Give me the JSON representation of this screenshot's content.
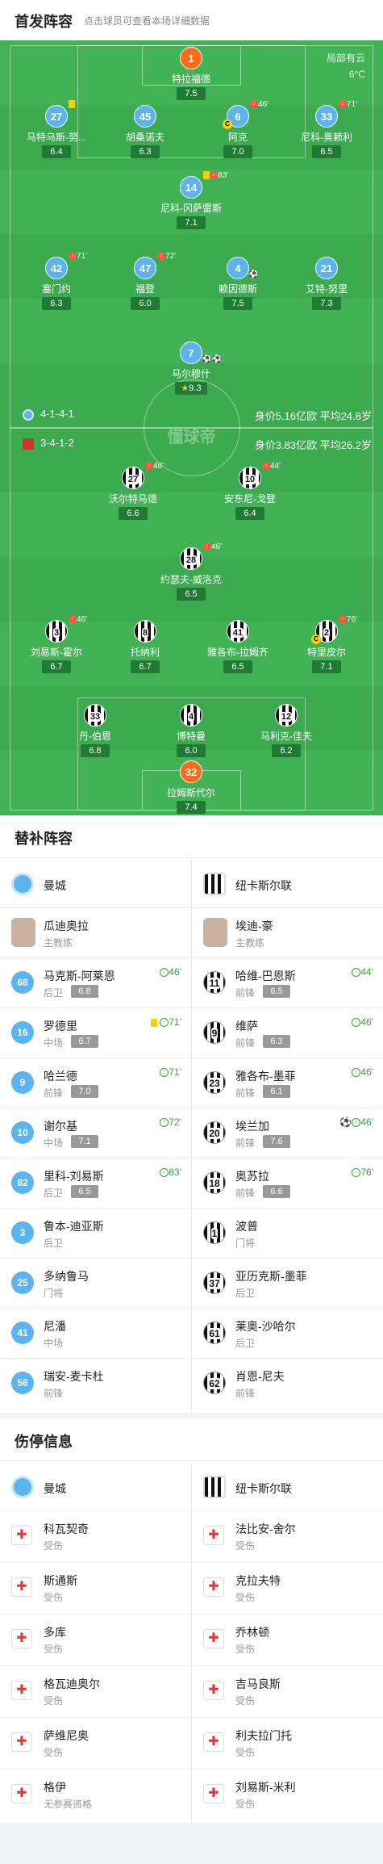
{
  "header": {
    "title": "首发阵容",
    "subtitle": "点击球员可查看本场详细数据"
  },
  "weather": {
    "line1": "局部有云",
    "line2": "6°C"
  },
  "watermark": "懂球帝",
  "home_form": {
    "formation": "4-1-4-1",
    "value": "身价5.16亿欧 平均24.8岁"
  },
  "away_form": {
    "formation": "3-4-1-2",
    "value": "身价3.83亿欧 平均26.2岁"
  },
  "home_players": [
    {
      "num": "1",
      "name": "特拉福德",
      "rating": "7.5",
      "kit": "g",
      "events": ""
    },
    {
      "num": "27",
      "name": "马特乌斯-努...",
      "rating": "6.4",
      "kit": "b",
      "events": "yellow"
    },
    {
      "num": "45",
      "name": "胡桑诺夫",
      "rating": "6.3",
      "kit": "b",
      "events": ""
    },
    {
      "num": "6",
      "name": "阿克",
      "rating": "7.0",
      "kit": "b",
      "events": "46'",
      "captain": "C"
    },
    {
      "num": "33",
      "name": "尼科-奥赖利",
      "rating": "6.5",
      "kit": "b",
      "events": "71'"
    },
    {
      "num": "14",
      "name": "尼科-冈萨雷斯",
      "rating": "7.1",
      "kit": "b",
      "events": "83'",
      "yellow": true
    },
    {
      "num": "42",
      "name": "塞门约",
      "rating": "6.3",
      "kit": "b",
      "events": "71'"
    },
    {
      "num": "47",
      "name": "福登",
      "rating": "6.0",
      "kit": "b",
      "events": "72'"
    },
    {
      "num": "4",
      "name": "赖因德斯",
      "rating": "7.5",
      "kit": "b",
      "events": "",
      "ball": "⚽"
    },
    {
      "num": "21",
      "name": "艾特-努里",
      "rating": "7.3",
      "kit": "b",
      "events": ""
    },
    {
      "num": "7",
      "name": "马尔穆什",
      "rating": "9.3",
      "kit": "b",
      "events": "",
      "ball": "⚽⚽",
      "star": "★"
    }
  ],
  "away_players": [
    {
      "num": "27",
      "name": "沃尔特马德",
      "rating": "6.6",
      "events": "46'"
    },
    {
      "num": "10",
      "name": "安东尼-戈登",
      "rating": "6.4",
      "events": "44'"
    },
    {
      "num": "28",
      "name": "约瑟夫-威洛克",
      "rating": "6.5",
      "events": "46'"
    },
    {
      "num": "3",
      "name": "刘易斯-霍尔",
      "rating": "6.7",
      "events": "46'"
    },
    {
      "num": "8",
      "name": "托纳利",
      "rating": "6.7",
      "events": ""
    },
    {
      "num": "41",
      "name": "雅各布-拉姆齐",
      "rating": "6.5",
      "events": ""
    },
    {
      "num": "2",
      "name": "特里皮尔",
      "rating": "7.1",
      "events": "76'",
      "captain": "C"
    },
    {
      "num": "33",
      "name": "丹-伯恩",
      "rating": "6.8",
      "events": ""
    },
    {
      "num": "4",
      "name": "博特曼",
      "rating": "6.0",
      "events": ""
    },
    {
      "num": "12",
      "name": "马利克-佳夫",
      "rating": "6.2",
      "events": ""
    },
    {
      "num": "32",
      "name": "拉姆斯代尔",
      "rating": "7.4",
      "events": "",
      "kit": "g"
    }
  ],
  "subs": {
    "title": "替补阵容",
    "home_team": "曼城",
    "away_team": "纽卡斯尔联",
    "home_coach": {
      "name": "瓜迪奥拉",
      "role": "主教练"
    },
    "away_coach": {
      "name": "埃迪-豪",
      "role": "主教练"
    },
    "home": [
      {
        "num": "68",
        "name": "马克斯-阿莱恩",
        "pos": "后卫",
        "rating": "6.8",
        "ev": "46'"
      },
      {
        "num": "16",
        "name": "罗德里",
        "pos": "中场",
        "rating": "6.7",
        "ev": "71'",
        "yellow": true
      },
      {
        "num": "9",
        "name": "哈兰德",
        "pos": "前锋",
        "rating": "7.0",
        "ev": "71'"
      },
      {
        "num": "10",
        "name": "谢尔基",
        "pos": "中场",
        "rating": "7.1",
        "ev": "72'"
      },
      {
        "num": "82",
        "name": "里科-刘易斯",
        "pos": "后卫",
        "rating": "6.5",
        "ev": "83'"
      },
      {
        "num": "3",
        "name": "鲁本-迪亚斯",
        "pos": "后卫",
        "rating": "",
        "ev": ""
      },
      {
        "num": "25",
        "name": "多纳鲁马",
        "pos": "门将",
        "rating": "",
        "ev": ""
      },
      {
        "num": "41",
        "name": "尼潘",
        "pos": "中场",
        "rating": "",
        "ev": ""
      },
      {
        "num": "56",
        "name": "瑞安-麦卡杜",
        "pos": "前锋",
        "rating": "",
        "ev": ""
      }
    ],
    "away": [
      {
        "num": "11",
        "name": "哈维-巴恩斯",
        "pos": "前锋",
        "rating": "6.5",
        "ev": "44'"
      },
      {
        "num": "9",
        "name": "维萨",
        "pos": "前锋",
        "rating": "6.3",
        "ev": "46'"
      },
      {
        "num": "23",
        "name": "雅各布-墨菲",
        "pos": "前锋",
        "rating": "6.1",
        "ev": "46'"
      },
      {
        "num": "20",
        "name": "埃兰加",
        "pos": "前锋",
        "rating": "7.6",
        "ev": "46'",
        "ball": "⚽"
      },
      {
        "num": "18",
        "name": "奥苏拉",
        "pos": "前锋",
        "rating": "6.6",
        "ev": "76'"
      },
      {
        "num": "1",
        "name": "波普",
        "pos": "门将",
        "rating": "",
        "ev": ""
      },
      {
        "num": "37",
        "name": "亚历克斯-墨菲",
        "pos": "后卫",
        "rating": "",
        "ev": ""
      },
      {
        "num": "61",
        "name": "莱奥-沙哈尔",
        "pos": "后卫",
        "rating": "",
        "ev": ""
      },
      {
        "num": "62",
        "name": "肖恩-尼夫",
        "pos": "前锋",
        "rating": "",
        "ev": ""
      }
    ]
  },
  "injuries": {
    "title": "伤停信息",
    "home_team": "曼城",
    "away_team": "纽卡斯尔联",
    "home": [
      {
        "name": "科瓦契奇",
        "status": "受伤"
      },
      {
        "name": "斯通斯",
        "status": "受伤"
      },
      {
        "name": "多库",
        "status": "受伤"
      },
      {
        "name": "格瓦迪奥尔",
        "status": "受伤"
      },
      {
        "name": "萨维尼奥",
        "status": "受伤"
      },
      {
        "name": "格伊",
        "status": "无参赛资格"
      }
    ],
    "away": [
      {
        "name": "法比安-舍尔",
        "status": "受伤"
      },
      {
        "name": "克拉夫特",
        "status": "受伤"
      },
      {
        "name": "乔林顿",
        "status": "受伤"
      },
      {
        "name": "吉马良斯",
        "status": "受伤"
      },
      {
        "name": "利夫拉门托",
        "status": "受伤"
      },
      {
        "name": "刘易斯-米利",
        "status": "受伤"
      }
    ]
  }
}
